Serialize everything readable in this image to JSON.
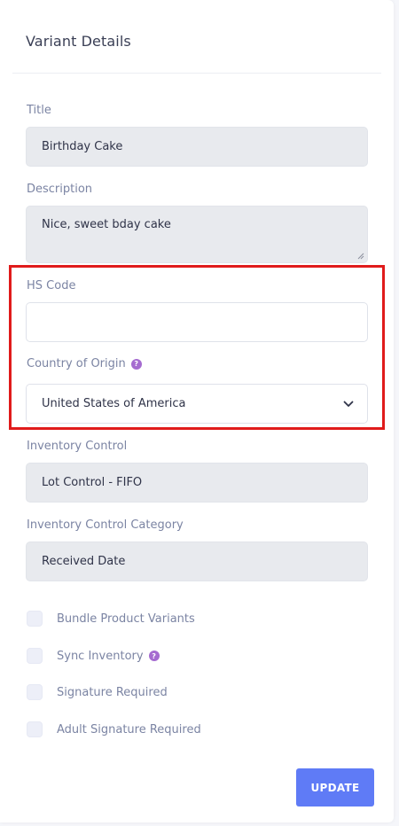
{
  "card": {
    "title": "Variant Details"
  },
  "fields": {
    "title": {
      "label": "Title",
      "value": "Birthday Cake"
    },
    "description": {
      "label": "Description",
      "value": "Nice, sweet bday cake"
    },
    "hs_code": {
      "label": "HS Code",
      "value": ""
    },
    "country_of_origin": {
      "label": "Country of Origin",
      "value": "United States of America",
      "help_icon": "question-mark-icon"
    },
    "inventory_control": {
      "label": "Inventory Control",
      "value": "Lot Control - FIFO"
    },
    "inventory_control_category": {
      "label": "Inventory Control Category",
      "value": "Received Date"
    }
  },
  "checkboxes": [
    {
      "label": "Bundle Product Variants",
      "checked": false
    },
    {
      "label": "Sync Inventory",
      "checked": false,
      "help_icon": "question-mark-icon"
    },
    {
      "label": "Signature Required",
      "checked": false
    },
    {
      "label": "Adult Signature Required",
      "checked": false
    }
  ],
  "actions": {
    "update_label": "UPDATE"
  },
  "colors": {
    "accent": "#5f7bf6",
    "help_icon": "#a56bd0",
    "highlight": "#e01b1b",
    "label": "#7b84a3",
    "disabled_field": "#e8eaee"
  }
}
